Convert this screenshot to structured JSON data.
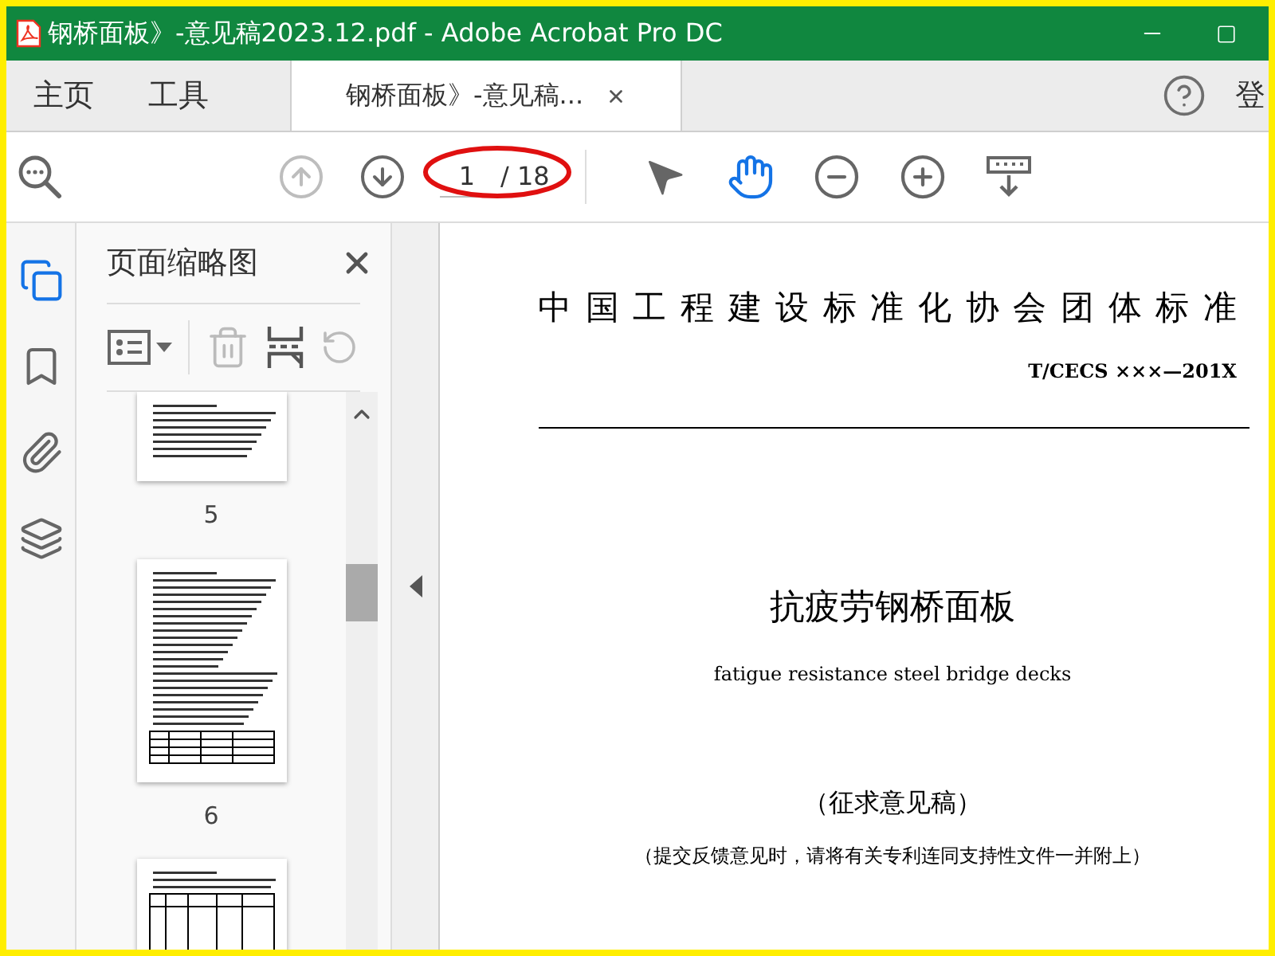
{
  "window": {
    "title": "钢桥面板》-意见稿2023.12.pdf - Adobe Acrobat Pro DC"
  },
  "tabs": [
    {
      "label": "主页",
      "selected": false
    },
    {
      "label": "工具",
      "selected": false
    },
    {
      "label": "钢桥面板》-意见稿...",
      "selected": true
    }
  ],
  "header_right": {
    "text": "登"
  },
  "toolbar": {
    "nav": [
      {
        "kind": "up",
        "disabled": true
      },
      {
        "kind": "down",
        "disabled": false
      }
    ],
    "page_current": "1",
    "page_total": "/ 18",
    "tools": [
      {
        "kind": "select",
        "selected": false
      },
      {
        "kind": "hand",
        "selected": true
      },
      {
        "kind": "zoom-out",
        "selected": false
      },
      {
        "kind": "zoom-in",
        "selected": false
      },
      {
        "kind": "scroll-mode",
        "selected": false
      }
    ]
  },
  "side_rail": [
    {
      "kind": "pages",
      "selected": true
    },
    {
      "kind": "bookmarks",
      "selected": false
    },
    {
      "kind": "attachments",
      "selected": false
    },
    {
      "kind": "layers",
      "selected": false
    }
  ],
  "thumbnail_panel": {
    "title": "页面缩略图",
    "thumbnails": [
      {
        "kind": "text-end",
        "label": "5"
      },
      {
        "kind": "text-table",
        "label": "6"
      },
      {
        "kind": "table"
      }
    ]
  },
  "document": {
    "header": "中国工程建设标准化协会团体标准",
    "code": "T/CECS ×××—201X",
    "title": "抗疲劳钢桥面板",
    "subtitle": "fatigue resistance steel bridge decks",
    "draft": "（征求意见稿）",
    "note": "（提交反馈意见时，请将有关专利连同支持性文件一并附上）"
  }
}
